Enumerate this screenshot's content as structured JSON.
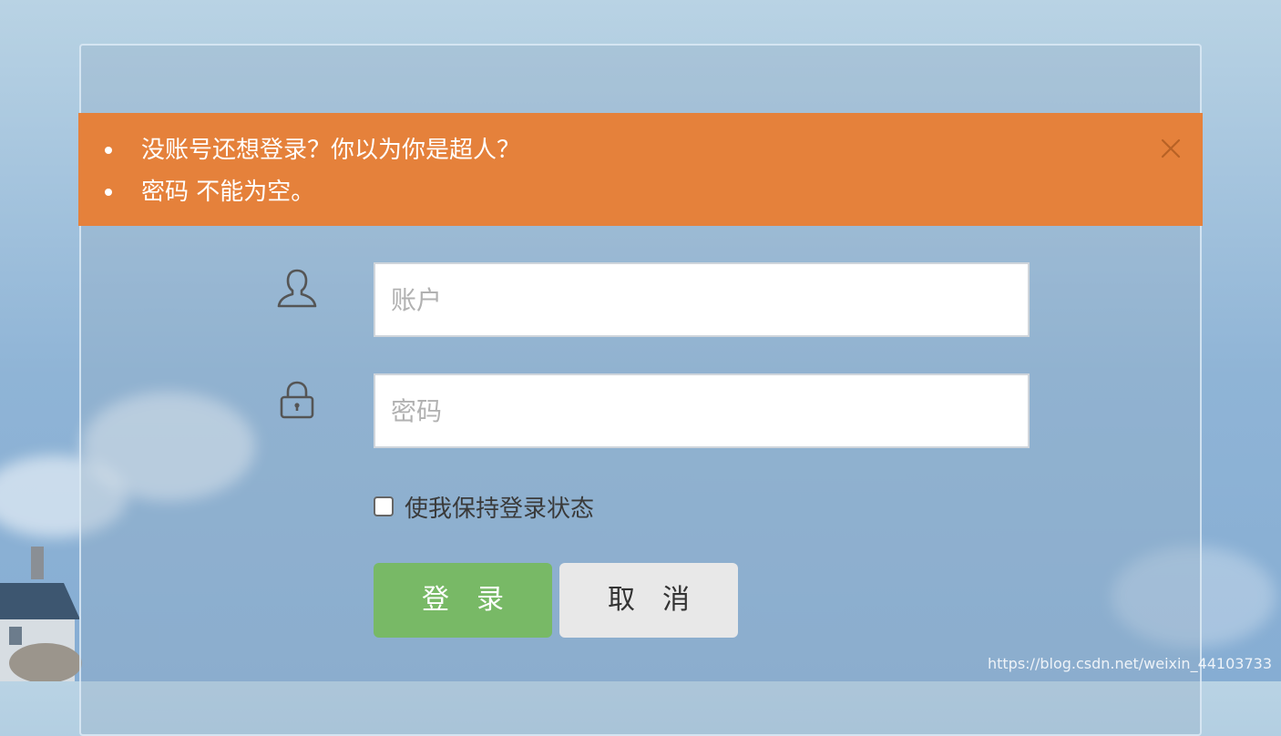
{
  "alert": {
    "messages": [
      "没账号还想登录？你以为你是超人？",
      "密码 不能为空。"
    ],
    "color": "#e5813b"
  },
  "form": {
    "username_placeholder": "账户",
    "password_placeholder": "密码",
    "remember_label": "使我保持登录状态",
    "login_label": "登　录",
    "cancel_label": "取　消"
  },
  "icons": {
    "user": "user-icon",
    "lock": "lock-icon",
    "close": "close-icon"
  },
  "colors": {
    "login_button": "#78b966",
    "cancel_button": "#e8e8e8"
  },
  "watermark": "https://blog.csdn.net/weixin_44103733"
}
